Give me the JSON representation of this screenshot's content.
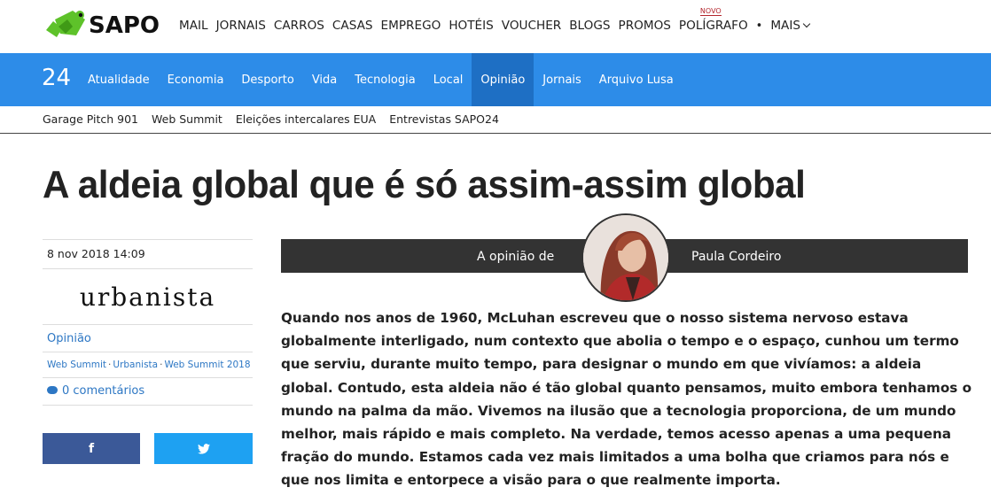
{
  "logo": {
    "text": "SAPO",
    "icon": "sapo-frog-logo",
    "color": "#5ec22a"
  },
  "topnav": {
    "items": [
      "MAIL",
      "JORNAIS",
      "CARROS",
      "CASAS",
      "EMPREGO",
      "HOTÉIS",
      "VOUCHER",
      "BLOGS",
      "PROMOS",
      "POLÍGRAFO"
    ],
    "new_badge": "NOVO",
    "separator": "•",
    "more": "MAIS"
  },
  "section_bar": {
    "brand": "24",
    "items": [
      "Atualidade",
      "Economia",
      "Desporto",
      "Vida",
      "Tecnologia",
      "Local",
      "Opinião",
      "Jornais",
      "Arquivo Lusa"
    ],
    "active": "Opinião",
    "color": "#2d8ce8",
    "active_color": "#1e6fc4"
  },
  "tags": [
    "Garage Pitch 901",
    "Web Summit",
    "Eleições intercalares EUA",
    "Entrevistas SAPO24"
  ],
  "article": {
    "title": "A aldeia global que é só assim-assim global",
    "date": "8 nov 2018 14:09",
    "column_brand": "urbanista",
    "section": "Opinião",
    "keywords": [
      "Web Summit",
      "Urbanista",
      "Web Summit 2018"
    ],
    "comments": "0 comentários",
    "opinion_label": "A opinião de",
    "author": "Paula Cordeiro",
    "body": "Quando nos anos de 1960, McLuhan escreveu que o nosso sistema nervoso estava globalmente interligado, num contexto que abolia o tempo e o espaço, cunhou um termo que serviu, durante muito tempo, para designar o mundo em que vivíamos: a aldeia global. Contudo, esta aldeia não é tão global quanto pensamos, muito embora tenhamos o mundo na palma da mão. Vivemos na ilusão que a tecnologia proporciona, de um mundo melhor, mais rápido e mais completo. Na verdade, temos acesso apenas a uma pequena fração do mundo. Estamos cada vez mais limitados a uma bolha que criamos para nós e que nos limita e entorpece a visão para o que realmente importa."
  },
  "share": {
    "facebook_icon": "facebook-icon",
    "facebook_glyph": "f",
    "facebook_color": "#3b5998",
    "twitter_icon": "twitter-icon",
    "twitter_color": "#1ea1f2"
  }
}
